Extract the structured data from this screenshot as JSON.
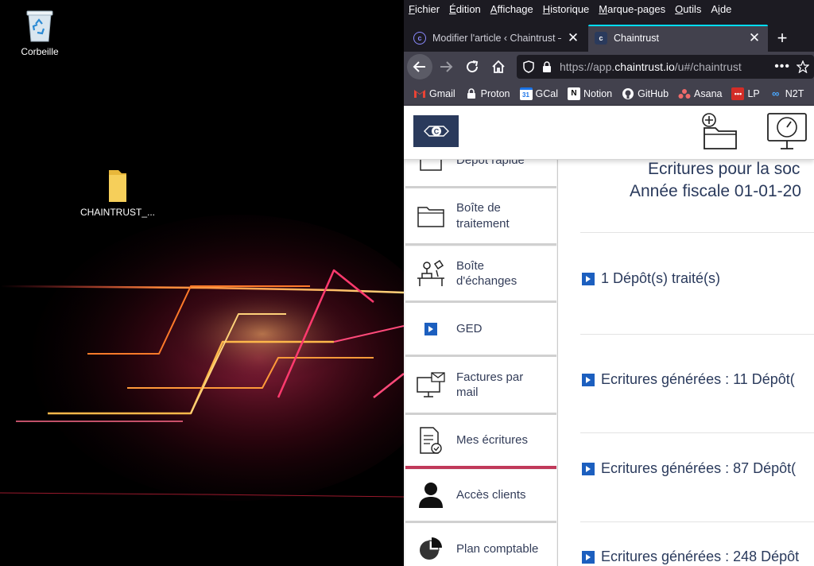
{
  "desktop": {
    "icons": [
      {
        "label": "Corbeille",
        "icon": "recycle-bin-icon"
      },
      {
        "label": "CHAINTRUST_...",
        "icon": "folder-icon"
      }
    ]
  },
  "browser": {
    "menu": [
      "Fichier",
      "Édition",
      "Affichage",
      "Historique",
      "Marque-pages",
      "Outils",
      "Aide"
    ],
    "tabs": [
      {
        "title": "Modifier l'article ‹ Chaintrust —",
        "active": false
      },
      {
        "title": "Chaintrust",
        "active": true
      }
    ],
    "url": {
      "prefix": "https://app.",
      "host": "chaintrust.io",
      "path": "/u#/chaintrust"
    },
    "bookmarks": [
      {
        "label": "Gmail",
        "icon": "gmail-icon"
      },
      {
        "label": "Proton",
        "icon": "proton-icon"
      },
      {
        "label": "GCal",
        "icon": "gcal-icon",
        "badge": "31"
      },
      {
        "label": "Notion",
        "icon": "notion-icon",
        "badge": "N"
      },
      {
        "label": "GitHub",
        "icon": "github-icon"
      },
      {
        "label": "Asana",
        "icon": "asana-icon"
      },
      {
        "label": "LP",
        "icon": "lastpass-icon"
      },
      {
        "label": "N2T",
        "icon": "n2t-icon"
      }
    ]
  },
  "app": {
    "sidebar": [
      {
        "label": "Dépôt rapide",
        "icon": "quick-deposit-icon"
      },
      {
        "label": "Boîte de traitement",
        "icon": "folder-outline-icon"
      },
      {
        "label": "Boîte d'échanges",
        "icon": "desk-exchange-icon"
      },
      {
        "label": "GED",
        "icon": "play-icon"
      },
      {
        "label": "Factures par mail",
        "icon": "computer-mail-icon"
      },
      {
        "label": "Mes écritures",
        "icon": "document-check-icon",
        "active": true
      },
      {
        "label": "Accès clients",
        "icon": "users-icon"
      },
      {
        "label": "Plan comptable",
        "icon": "pie-chart-icon"
      }
    ],
    "main": {
      "title_line1": "Ecritures pour la soc",
      "title_line2": "Année fiscale 01-01-20",
      "entries": [
        "1 Dépôt(s) traité(s)",
        "Ecritures générées : 11 Dépôt(",
        "Ecritures générées : 87 Dépôt(",
        "Ecritures générées : 248 Dépôt"
      ]
    }
  },
  "colors": {
    "accent": "#c0395a",
    "brand": "#2a3a5c",
    "play": "#1c5fbf",
    "tab_highlight": "#00ddff"
  }
}
